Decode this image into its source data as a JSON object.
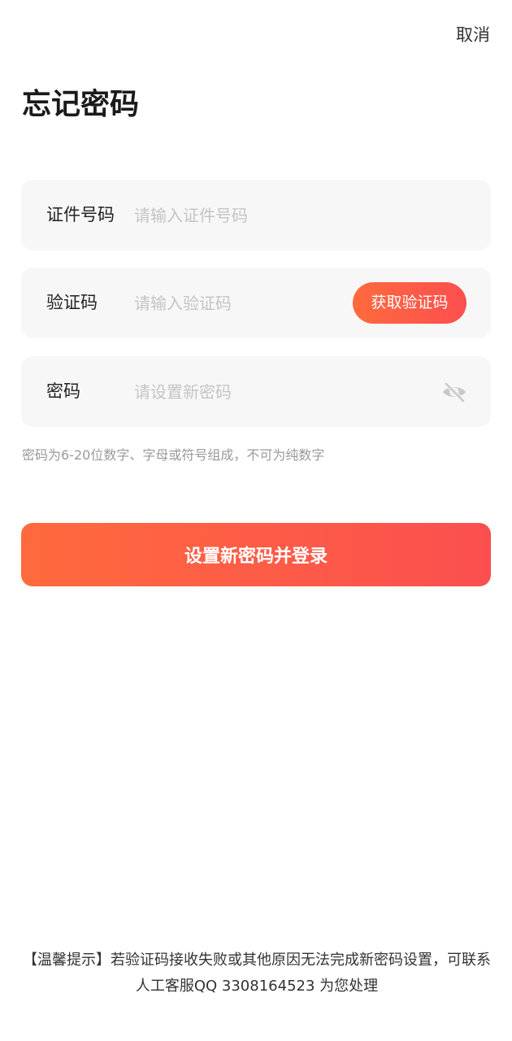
{
  "header": {
    "cancel_label": "取消",
    "title": "忘记密码"
  },
  "form": {
    "id_field": {
      "label": "证件号码",
      "placeholder": "请输入证件号码"
    },
    "code_field": {
      "label": "验证码",
      "placeholder": "请输入验证码",
      "button_label": "获取验证码"
    },
    "password_field": {
      "label": "密码",
      "placeholder": "请设置新密码",
      "toggle_icon": "eye-off-icon"
    },
    "hint": "密码为6-20位数字、字母或符号组成，不可为纯数字",
    "submit_label": "设置新密码并登录"
  },
  "footer": {
    "tip": "【温馨提示】若验证码接收失败或其他原因无法完成新密码设置，可联系人工客服QQ 3308164523 为您处理"
  },
  "colors": {
    "accent_start": "#ff6a3d",
    "accent_end": "#fb4f4f",
    "field_bg": "#f7f7f7",
    "placeholder": "#c4c4c4",
    "hint": "#9a9a9a"
  }
}
